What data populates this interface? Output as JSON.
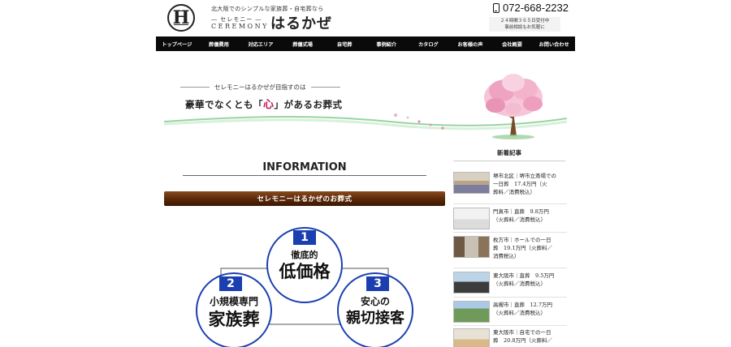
{
  "header": {
    "logo_letter": "H",
    "tagline": "北大阪でのシンプルな家族葬・自宅葬なら",
    "brand_sub": "― セレモニー ―",
    "brand_en": "CEREMONY",
    "brand_name": "はるかぜ",
    "phone": "072-668-2232",
    "hours_line1": "２４時間３６５日受付中",
    "hours_line2": "事前相談もお気軽に"
  },
  "nav": {
    "items": [
      "トップページ",
      "葬儀費用",
      "対応エリア",
      "葬儀式場",
      "自宅葬",
      "事例紹介",
      "カタログ",
      "お客様の声",
      "会社概要",
      "お問い合わせ"
    ]
  },
  "hero": {
    "line1": "セレモニーはるかぜが目指すのは",
    "title_pre": "豪華でなくとも「",
    "title_accent": "心",
    "title_post": "」があるお葬式"
  },
  "main": {
    "info_heading": "INFORMATION",
    "banner": "セレモニーはるかぜのお葬式",
    "features": [
      {
        "num": "1",
        "line1": "徹底的",
        "line2": "低価格"
      },
      {
        "num": "2",
        "line1": "小規模専門",
        "line2": "家族葬"
      },
      {
        "num": "3",
        "line1": "安心の",
        "line2": "親切接客"
      }
    ]
  },
  "sidebar": {
    "title": "新着記事",
    "posts": [
      {
        "line1": "堺市北区｜堺市立斎場での",
        "line2": "一日葬　17.4万円（火",
        "line3": "葬料／消費税込）"
      },
      {
        "line1": "門真市｜直葬　9.8万円",
        "line2": "（火葬料／消費税込）",
        "line3": ""
      },
      {
        "line1": "枚方市｜ホールでの一日",
        "line2": "葬　19.1万円（火葬料／",
        "line3": "消費税込）"
      },
      {
        "line1": "東大阪市｜直葬　9.5万円",
        "line2": "（火葬料／消費税込）",
        "line3": ""
      },
      {
        "line1": "高槻市｜直葬　12.7万円",
        "line2": "（火葬料／消費税込）",
        "line3": ""
      },
      {
        "line1": "東大阪市｜自宅での一日",
        "line2": "葬　20.8万円（火葬料／",
        "line3": ""
      }
    ]
  },
  "colors": {
    "nav_bg": "#0a0a0a",
    "badge_blue": "#1a3fb0",
    "accent_pink": "#c2185b",
    "banner_brown": "#5c2a0a"
  }
}
